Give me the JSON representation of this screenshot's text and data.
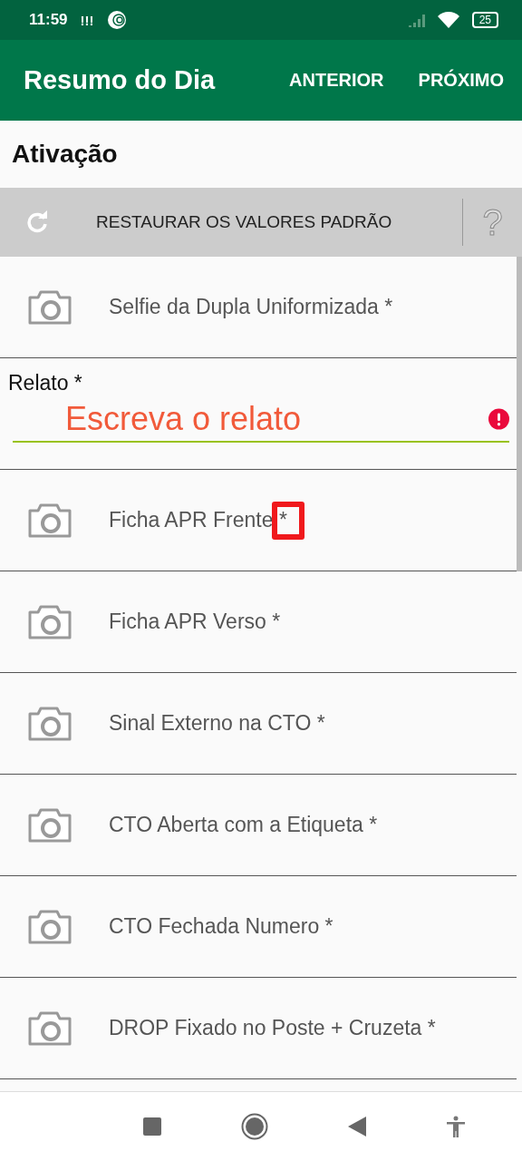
{
  "status_bar": {
    "time": "11:59",
    "alert": "!!!",
    "battery": "25"
  },
  "app_bar": {
    "title": "Resumo do Dia",
    "actions": [
      "ANTERIOR",
      "PRÓXIMO"
    ]
  },
  "section_title": "Ativação",
  "restore_bar": {
    "label": "RESTAURAR OS VALORES PADRÃO",
    "help": "?"
  },
  "items": [
    {
      "kind": "photo",
      "label": "Selfie da Dupla Uniformizada *",
      "highlighted": false
    },
    {
      "kind": "text",
      "label": "Relato *",
      "placeholder": "Escreva o relato",
      "error": true
    },
    {
      "kind": "photo",
      "label": "Ficha APR Frente *",
      "highlighted": true
    },
    {
      "kind": "photo",
      "label": "Ficha APR Verso *",
      "highlighted": false
    },
    {
      "kind": "photo",
      "label": "Sinal Externo na CTO *",
      "highlighted": false
    },
    {
      "kind": "photo",
      "label": "CTO Aberta com a Etiqueta *",
      "highlighted": false
    },
    {
      "kind": "photo",
      "label": "CTO Fechada Numero *",
      "highlighted": false
    },
    {
      "kind": "photo",
      "label": "DROP Fixado no Poste + Cruzeta *",
      "highlighted": false
    }
  ]
}
